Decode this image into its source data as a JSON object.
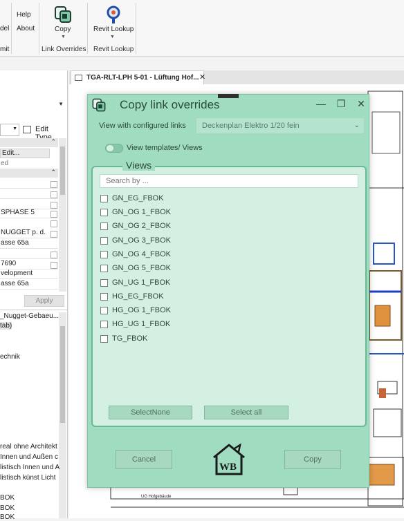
{
  "ribbon": {
    "menu_fragment_1": "del",
    "menu_fragment_2": "mit",
    "help_label": "Help",
    "about_label": "About",
    "copy_label": "Copy",
    "revit_lookup_label": "Revit Lookup",
    "panel_link_overrides": "Link Overrides",
    "panel_revit_lookup": "Revit Lookup"
  },
  "left_panel": {
    "edit_type_label": "Edit Type",
    "edit_label": "Edit...",
    "rows": [
      "ed",
      "",
      "",
      "",
      "SPHASE 5",
      "NUGGET p. d.",
      "asse 65a",
      "",
      "7690",
      "velopment",
      "asse 65a"
    ],
    "apply_label": "Apply",
    "tree_items": [
      "_Nugget-Gebaeu...",
      "tab)",
      "",
      "",
      "echnik"
    ],
    "bottom_items": [
      "real ohne Architekt",
      "Innen und Außen c",
      "listisch Innen und A",
      "listisch künst Licht",
      "",
      "BOK",
      "BOK",
      "BOK"
    ]
  },
  "view_tab": {
    "title": "TGA-RLT-LPH 5-01 - Lüftung Hof...",
    "close_glyph": "✕",
    "drawing_caption": "UG Hofgebäude"
  },
  "dialog": {
    "title": "Copy link overrides",
    "view_combo_label": "View with configured links",
    "view_combo_value": "Deckenplan Elektro 1/20 fein",
    "toggle_label": "View templates/ Views",
    "views_legend": "Views",
    "search_placeholder": "Search by ...",
    "views": [
      {
        "label": "GN_EG_FBOK",
        "checked": false
      },
      {
        "label": "GN_OG 1_FBOK",
        "checked": false
      },
      {
        "label": "GN_OG 2_FBOK",
        "checked": false
      },
      {
        "label": "GN_OG 3_FBOK",
        "checked": false
      },
      {
        "label": "GN_OG 4_FBOK",
        "checked": false
      },
      {
        "label": "GN_OG 5_FBOK",
        "checked": false
      },
      {
        "label": "GN_UG 1_FBOK",
        "checked": false
      },
      {
        "label": "HG_EG_FBOK",
        "checked": false
      },
      {
        "label": "HG_OG 1_FBOK",
        "checked": false
      },
      {
        "label": "HG_UG 1_FBOK",
        "checked": false
      },
      {
        "label": "TG_FBOK",
        "checked": false
      }
    ],
    "select_none_label": "SelectNone",
    "select_all_label": "Select all",
    "cancel_label": "Cancel",
    "copy_label": "Copy",
    "logo_text": "WB",
    "minimize_glyph": "—",
    "maximize_glyph": "❐",
    "close_glyph": "✕"
  },
  "colors": {
    "dialog_bg": "#9fdcc0",
    "views_bg": "#d4f0e2",
    "accent": "#6ab896"
  }
}
